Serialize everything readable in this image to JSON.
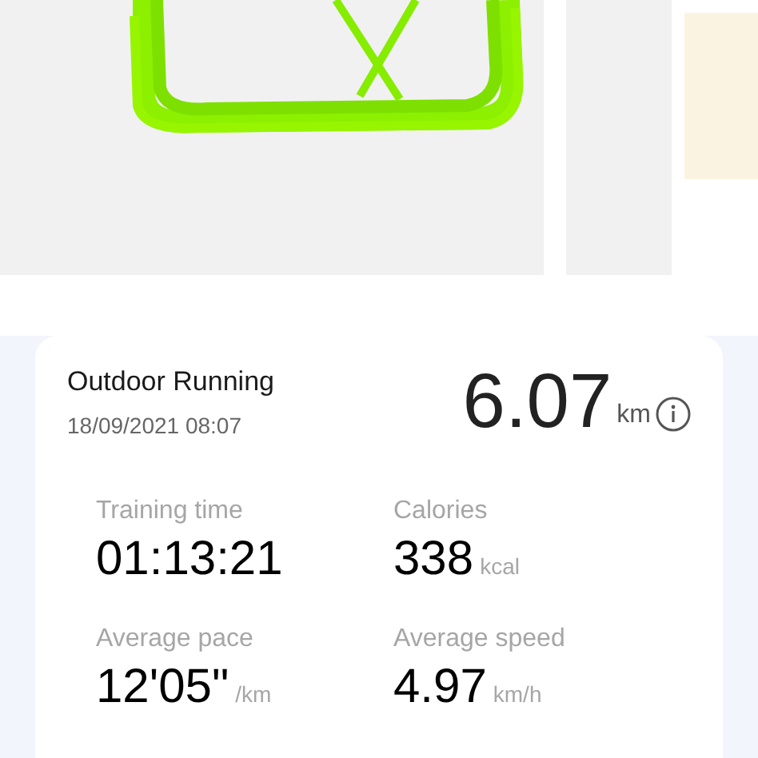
{
  "workout": {
    "title": "Outdoor Running",
    "datetime": "18/09/2021 08:07",
    "distance": "6.07",
    "distance_unit": "km"
  },
  "stats": [
    {
      "label": "Training time",
      "value": "01:13:21"
    },
    {
      "label": "Calories",
      "value": "338",
      "unit": "kcal"
    },
    {
      "label": "Average pace",
      "value": "12'05\"",
      "unit": "/km"
    },
    {
      "label": "Average speed",
      "value": "4.97",
      "unit": "km/h"
    }
  ]
}
